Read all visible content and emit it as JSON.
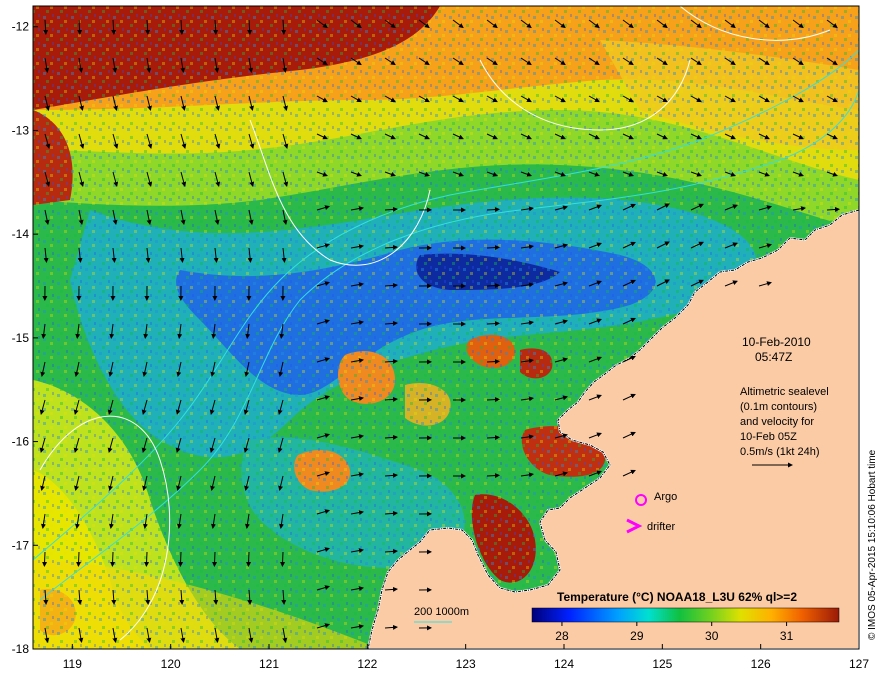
{
  "map": {
    "lon_range": [
      118.6,
      127
    ],
    "lat_range": [
      -18,
      -11.8
    ],
    "x_ticks": [
      119,
      120,
      121,
      122,
      123,
      124,
      125,
      126,
      127
    ],
    "y_ticks": [
      -12,
      -13,
      -14,
      -15,
      -16,
      -17,
      -18
    ],
    "date": "10-Feb-2010",
    "time": "05:47Z",
    "legend_notes": [
      "Altimetric sealevel",
      "(0.1m contours)",
      "and velocity for",
      "10-Feb 05Z",
      "0.5m/s (1kt 24h)"
    ],
    "argo_label": "Argo",
    "drifter_label": "drifter",
    "isobath_label": "200  1000m",
    "colorbar": {
      "title": "Temperature (°C) NOAA18_L3U 62% ql>=2",
      "ticks": [
        "28",
        "29",
        "30",
        "31"
      ],
      "range": [
        27.6,
        31.7
      ]
    },
    "credit": "© IMOS 05-Apr-2015 15:10:06 Hobart time",
    "colors": {
      "land": "#fbcba6",
      "coast": "#ffffff",
      "isobath": "#33e0e0",
      "sealevel_contour": "#ffffff",
      "marker": "#ff00ff",
      "sst_cold": "#000080",
      "sst_warm": "#9a1a08"
    }
  }
}
